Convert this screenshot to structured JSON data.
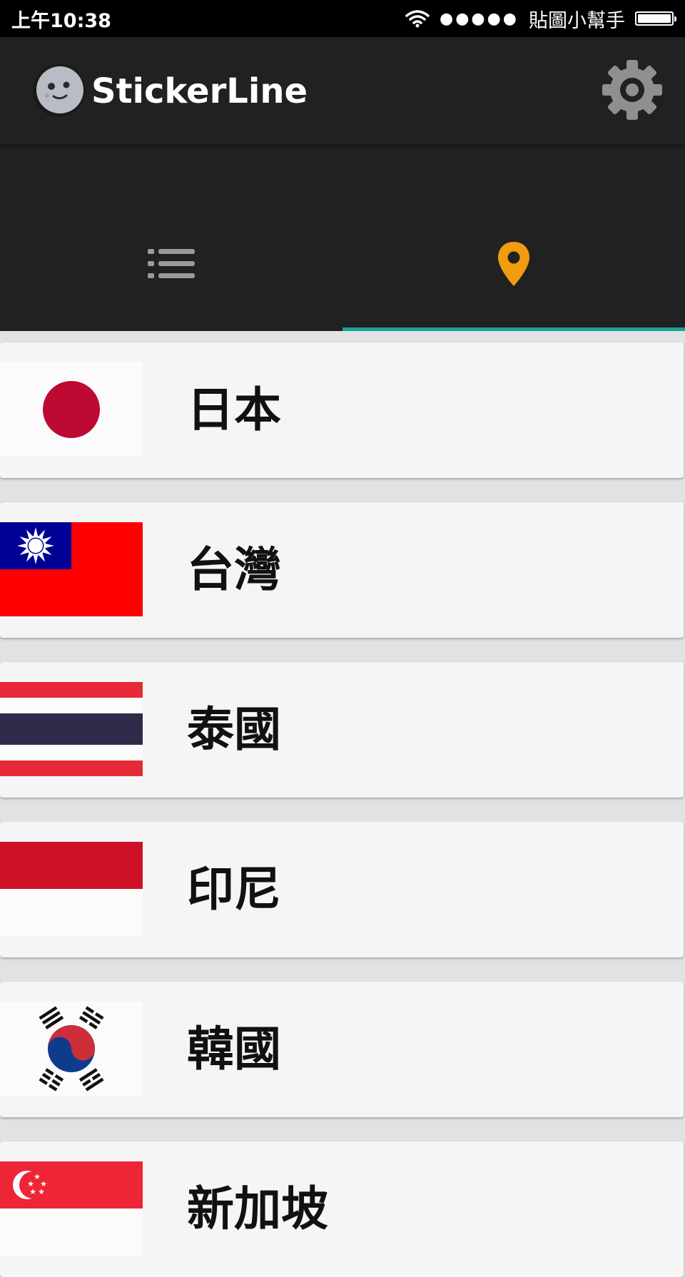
{
  "status_bar": {
    "time": "上午10:38",
    "signal": "●●●●●",
    "carrier": "貼圖小幫手"
  },
  "app_bar": {
    "title": "StickerLine",
    "logo_icon": "moon-face-icon",
    "settings_icon": "gear-icon"
  },
  "tabs": [
    {
      "icon": "list-icon",
      "selected": false
    },
    {
      "icon": "location-pin-icon",
      "selected": true
    }
  ],
  "colors": {
    "app_bar": "#212121",
    "tab_indicator": "#1a9f94",
    "location_pin": "#f29b10",
    "card_background": "#f5f5f5"
  },
  "countries": [
    {
      "name": "日本",
      "flag": "japan-flag-icon"
    },
    {
      "name": "台灣",
      "flag": "taiwan-flag-icon"
    },
    {
      "name": "泰國",
      "flag": "thailand-flag-icon"
    },
    {
      "name": "印尼",
      "flag": "indonesia-flag-icon"
    },
    {
      "name": "韓國",
      "flag": "korea-flag-icon"
    },
    {
      "name": "新加坡",
      "flag": "singapore-flag-icon"
    }
  ]
}
